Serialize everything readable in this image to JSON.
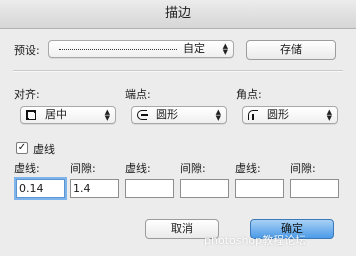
{
  "window": {
    "title": "描边"
  },
  "preset": {
    "label": "预设:",
    "value": "自定",
    "store_button": "存储"
  },
  "align": {
    "label": "对齐:",
    "value": "居中",
    "icon": "align-center-icon"
  },
  "caps": {
    "label": "端点:",
    "value": "圆形",
    "icon": "round-cap-icon"
  },
  "corners": {
    "label": "角点:",
    "value": "圆形",
    "icon": "round-corner-icon"
  },
  "dashed": {
    "checkbox_label": "虚线",
    "checked": true,
    "fields": [
      {
        "label": "虚线:",
        "value": "0.14"
      },
      {
        "label": "间隙:",
        "value": "1.4"
      },
      {
        "label": "虚线:",
        "value": ""
      },
      {
        "label": "间隙:",
        "value": ""
      },
      {
        "label": "虚线:",
        "value": ""
      },
      {
        "label": "间隙:",
        "value": ""
      }
    ]
  },
  "buttons": {
    "cancel": "取消",
    "ok": "确定"
  },
  "watermark": "photoshop教程论坛",
  "colors": {
    "primary_button": "#4a9be8",
    "focus_ring": "#7eb4ea",
    "background": "#ececec"
  }
}
